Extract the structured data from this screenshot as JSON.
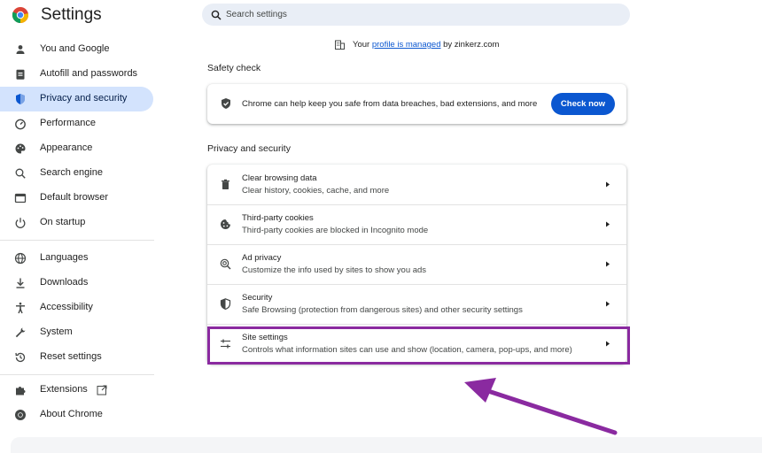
{
  "app": {
    "title": "Settings",
    "logo_icon": "chrome-logo-icon"
  },
  "search": {
    "placeholder": "Search settings"
  },
  "sidebar": {
    "items": [
      {
        "label": "You and Google",
        "icon": "person-icon"
      },
      {
        "label": "Autofill and passwords",
        "icon": "clipboard-icon"
      },
      {
        "label": "Privacy and security",
        "icon": "shield-icon",
        "active": true
      },
      {
        "label": "Performance",
        "icon": "speedometer-icon"
      },
      {
        "label": "Appearance",
        "icon": "palette-icon"
      },
      {
        "label": "Search engine",
        "icon": "search-icon"
      },
      {
        "label": "Default browser",
        "icon": "browser-window-icon"
      },
      {
        "label": "On startup",
        "icon": "power-icon"
      },
      {
        "label": "Languages",
        "icon": "globe-icon"
      },
      {
        "label": "Downloads",
        "icon": "download-icon"
      },
      {
        "label": "Accessibility",
        "icon": "accessibility-icon"
      },
      {
        "label": "System",
        "icon": "wrench-icon"
      },
      {
        "label": "Reset settings",
        "icon": "reset-icon"
      },
      {
        "label": "Extensions",
        "icon": "puzzle-icon"
      },
      {
        "label": "About Chrome",
        "icon": "chrome-icon"
      }
    ]
  },
  "managed": {
    "prefix": "Your",
    "link": "profile is managed",
    "suffix": "by zinkerz.com"
  },
  "safety_check": {
    "section_title": "Safety check",
    "text": "Chrome can help keep you safe from data breaches, bad extensions, and more",
    "button_label": "Check now"
  },
  "privacy": {
    "section_title": "Privacy and security",
    "rows": [
      {
        "title": "Clear browsing data",
        "subtitle": "Clear history, cookies, cache, and more",
        "icon": "trash-icon"
      },
      {
        "title": "Third-party cookies",
        "subtitle": "Third-party cookies are blocked in Incognito mode",
        "icon": "cookie-icon"
      },
      {
        "title": "Ad privacy",
        "subtitle": "Customize the info used by sites to show you ads",
        "icon": "ad-privacy-icon"
      },
      {
        "title": "Security",
        "subtitle": "Safe Browsing (protection from dangerous sites) and other security settings",
        "icon": "shield-icon"
      },
      {
        "title": "Site settings",
        "subtitle": "Controls what information sites can use and show (location, camera, pop-ups, and more)",
        "icon": "sliders-icon"
      }
    ]
  },
  "colors": {
    "accent": "#0b57d0",
    "active_nav": "#d3e3fd",
    "annotation": "#8a2aa0"
  }
}
